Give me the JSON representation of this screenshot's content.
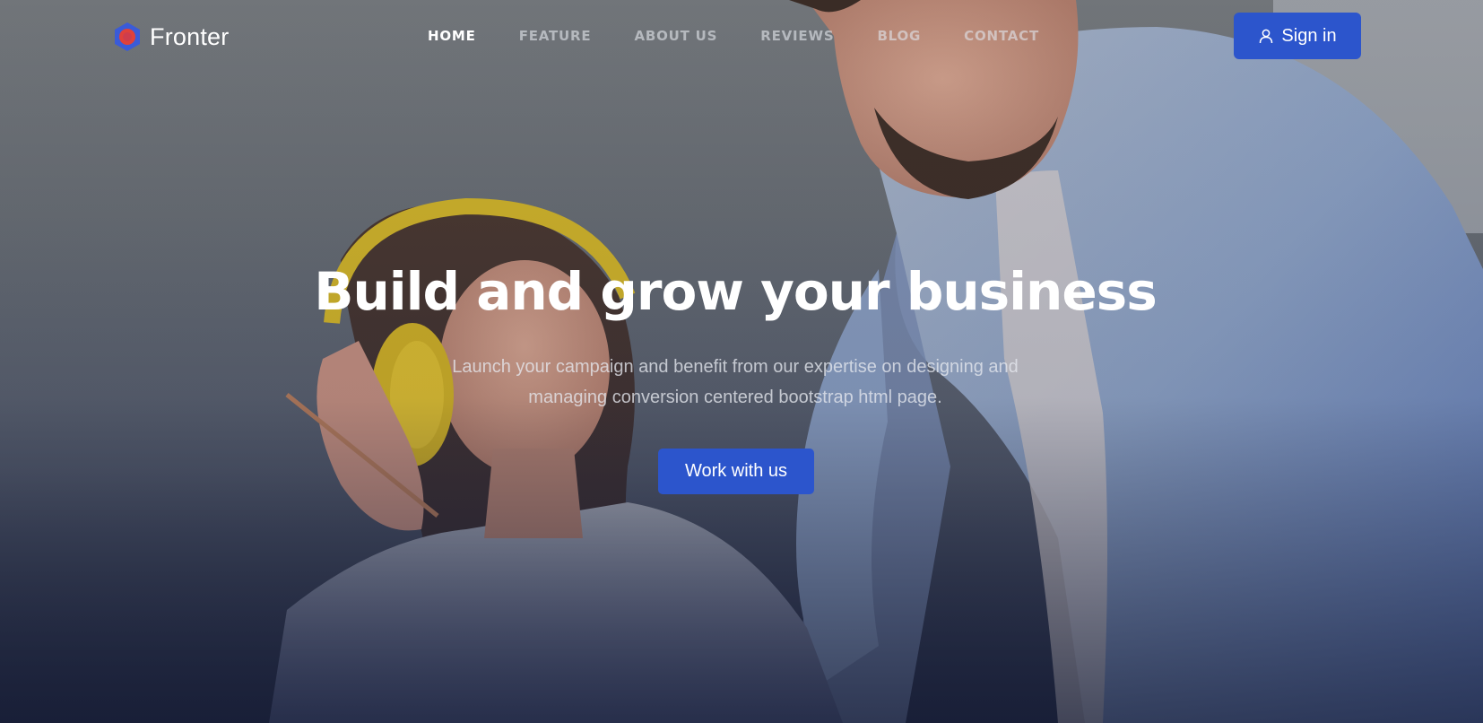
{
  "brand": {
    "name": "Fronter",
    "logo_icon": "hexagon-logo-icon"
  },
  "nav": {
    "items": [
      {
        "label": "HOME",
        "active": true
      },
      {
        "label": "FEATURE",
        "active": false
      },
      {
        "label": "ABOUT US",
        "active": false
      },
      {
        "label": "REVIEWS",
        "active": false
      },
      {
        "label": "BLOG",
        "active": false
      },
      {
        "label": "CONTACT",
        "active": false
      }
    ],
    "signin_label": "Sign in",
    "signin_icon": "user-icon"
  },
  "hero": {
    "title": "Build and grow your business",
    "subtitle_line1": "Launch your campaign and benefit from our expertise on designing and",
    "subtitle_line2": "managing conversion centered bootstrap html page.",
    "cta_label": "Work with us"
  },
  "colors": {
    "accent": "#2c55cc",
    "text_light": "#ffffff",
    "nav_inactive": "#b9bdc4",
    "logo_outer": "#3a5bd8",
    "logo_inner": "#e0413a"
  }
}
